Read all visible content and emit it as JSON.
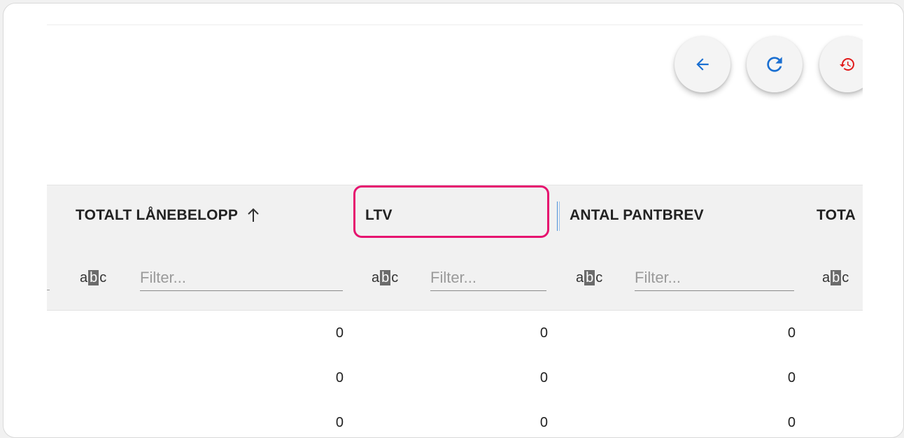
{
  "toolbar": {
    "back_icon": "arrow-left-icon",
    "refresh_icon": "refresh-icon",
    "history_icon": "history-icon",
    "accent_blue": "#1a6fd1",
    "accent_red": "#e11b1b"
  },
  "grid": {
    "columns": [
      {
        "title": "TOTALT LÅNEBELOPP",
        "sorted": "ascending"
      },
      {
        "title": "LTV",
        "highlighted": true
      },
      {
        "title": "ANTAL PANTBREV"
      },
      {
        "title": "TOTA"
      }
    ],
    "filter": {
      "type_icon": "abc-text-icon",
      "placeholder": "Filter...",
      "type_letters": [
        "a",
        "b",
        "c"
      ]
    },
    "rows": [
      {
        "cells": [
          "0",
          "0",
          "0"
        ]
      },
      {
        "cells": [
          "0",
          "0",
          "0"
        ]
      },
      {
        "cells": [
          "0",
          "0",
          "0"
        ]
      }
    ]
  },
  "highlight_color": "#e6136f"
}
